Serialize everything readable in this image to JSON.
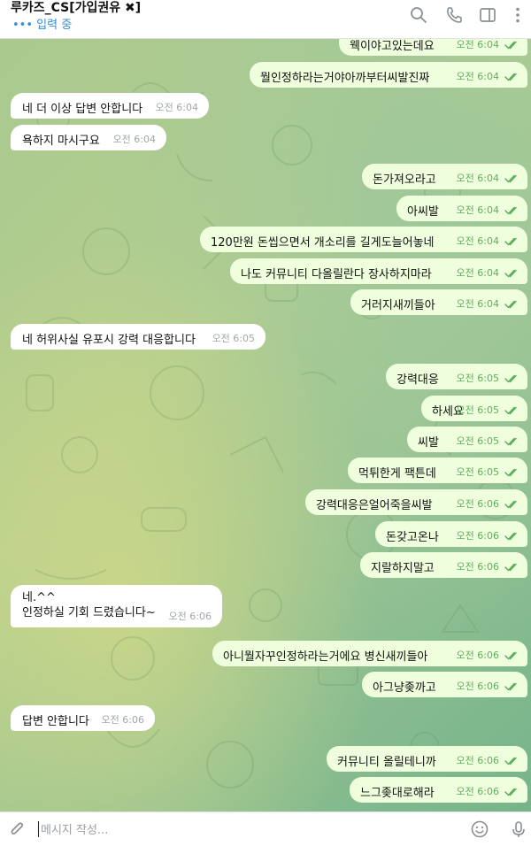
{
  "header": {
    "title": "루카즈_CS[가입권유 ✖]",
    "status": "••• 입력 중",
    "icons": [
      "search-icon",
      "phone-icon",
      "sidebar-icon",
      "more-icon"
    ]
  },
  "messages": [
    {
      "dir": "out",
      "text": "웩이야고있는데요",
      "time": "오전 6:04"
    },
    {
      "dir": "out",
      "text": "뭘인정하라는거야아까부터씨발진짜",
      "time": "오전 6:04"
    },
    {
      "dir": "in",
      "text": "네 더 이상 답변 안합니다",
      "time": "오전 6:04"
    },
    {
      "dir": "in",
      "text": "욕하지 마시구요",
      "time": "오전 6:04"
    },
    {
      "dir": "out",
      "text": "돈가져오라고",
      "time": "오전 6:04"
    },
    {
      "dir": "out",
      "text": "아씨발",
      "time": "오전 6:04"
    },
    {
      "dir": "out",
      "text": "120만원 돈씹으면서 개소리를 길게도늘어놓네",
      "time": "오전 6:04"
    },
    {
      "dir": "out",
      "text": "나도 커뮤니티 다올릴란다 장사하지마라",
      "time": "오전 6:04"
    },
    {
      "dir": "out",
      "text": "거러지새끼들아",
      "time": "오전 6:04"
    },
    {
      "dir": "in",
      "text": "네 허위사실 유포시 강력 대응합니다",
      "time": "오전 6:05"
    },
    {
      "dir": "out",
      "text": "강력대응",
      "time": "오전 6:05"
    },
    {
      "dir": "out",
      "text": "하세요",
      "time": "오전 6:05"
    },
    {
      "dir": "out",
      "text": "씨발",
      "time": "오전 6:05"
    },
    {
      "dir": "out",
      "text": "먹튀한게 팩튼데",
      "time": "오전 6:05"
    },
    {
      "dir": "out",
      "text": "강력대응은얼어죽을씨발",
      "time": "오전 6:06"
    },
    {
      "dir": "out",
      "text": "돈갖고온나",
      "time": "오전 6:06"
    },
    {
      "dir": "out",
      "text": "지랄하지말고",
      "time": "오전 6:06"
    },
    {
      "dir": "in",
      "line1": "네.^^",
      "line2": "인정하실 기회 드렸습니다~",
      "time": "오전 6:06"
    },
    {
      "dir": "out",
      "text": "아니뭘자꾸인정하라는거에요 병신새끼들아",
      "time": "오전 6:06"
    },
    {
      "dir": "out",
      "text": "아그냥좆까고",
      "time": "오전 6:06"
    },
    {
      "dir": "in",
      "text": "답변 안합니다",
      "time": "오전 6:06"
    },
    {
      "dir": "out",
      "text": "커뮤니티 올릴테니까",
      "time": "오전 6:06"
    },
    {
      "dir": "out",
      "text": "느그좆대로해라",
      "time": "오전 6:06"
    }
  ],
  "composer": {
    "placeholder": "메시지 작성...",
    "icons": [
      "attach-icon",
      "emoji-icon",
      "microphone-icon"
    ]
  },
  "colors": {
    "outgoing_bubble": "#effedd",
    "incoming_bubble": "#ffffff",
    "read_check": "#5fae5f",
    "typing_status": "#3a8bd0"
  }
}
